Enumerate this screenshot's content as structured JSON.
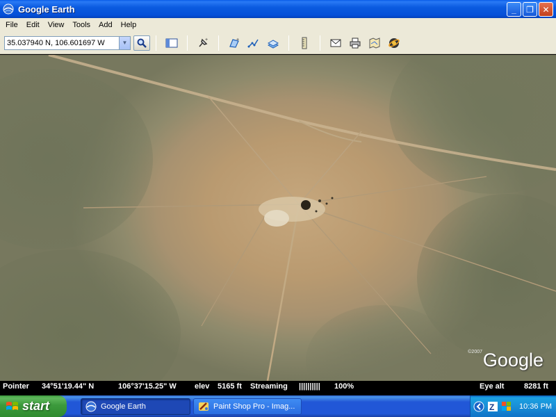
{
  "window": {
    "title": "Google Earth",
    "buttons": {
      "minimize": "_",
      "maximize": "❐",
      "close": "✕"
    }
  },
  "menu": [
    "File",
    "Edit",
    "View",
    "Tools",
    "Add",
    "Help"
  ],
  "toolbar": {
    "coordinates_value": "35.037940 N, 106.601697 W",
    "icons": [
      "sidebar-icon",
      "placemark-icon",
      "polygon-icon",
      "path-icon",
      "image-overlay-icon",
      "ruler-icon",
      "email-icon",
      "print-icon",
      "maps-icon",
      "sky-icon"
    ]
  },
  "map": {
    "copyright": "©2007",
    "logo": "Google",
    "colors": {
      "center": "#c6a77d",
      "vegetation": "#6f745a"
    }
  },
  "status": {
    "pointer_label": "Pointer",
    "lat": "34°51'19.44\" N",
    "lon": "106°37'15.25\" W",
    "elev_label": "elev",
    "elev_value": "5165 ft",
    "streaming_label": "Streaming",
    "streaming_bar": "||||||||||",
    "streaming_pct": "100%",
    "eye_alt_label": "Eye alt",
    "eye_alt_value": "8281 ft"
  },
  "taskbar": {
    "start_label": "start",
    "tasks": [
      {
        "label": "Google Earth",
        "active": true
      },
      {
        "label": "Paint Shop Pro - Imag...",
        "active": false
      }
    ],
    "clock": "10:36 PM"
  }
}
